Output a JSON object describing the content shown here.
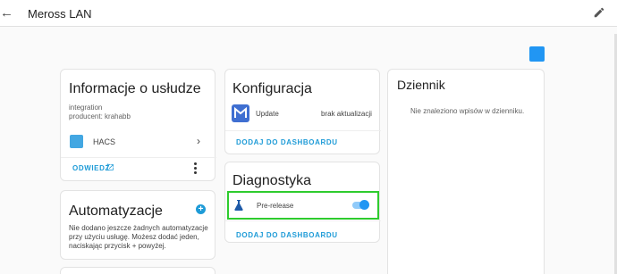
{
  "header": {
    "title": "Meross LAN",
    "back_icon": "arrow-back-icon",
    "edit_icon": "pencil-icon"
  },
  "device_card": {
    "title": "Informacje o usłudze",
    "integration_label": "integration",
    "producer_label": "producent: krahabb",
    "item_label": "HACS",
    "item_icon": "hacs-icon",
    "visit_label": "ODWIEDŹ",
    "visit_icon": "open-in-new-icon",
    "menu_icon": "more-vertical-icon"
  },
  "automation_card": {
    "title": "Automatyzacje",
    "add_icon": "plus-icon",
    "add_symbol": "+",
    "text_line1": "Nie dodano jeszcze żadnych automatyzacje",
    "text_line2": "przy użyciu usługę. Możesz dodać jeden,",
    "text_line3": "naciskając przycisk + powyżej."
  },
  "config_card": {
    "title": "Konfiguracja",
    "update_label": "Update",
    "update_status": "brak aktualizacji",
    "add_dashboard": "DODAJ DO DASHBOARDU"
  },
  "diag_card": {
    "title": "Diagnostyka",
    "prerelease_label": "Pre-release",
    "prerelease_icon": "flask-icon",
    "prerelease_on": true,
    "add_dashboard": "DODAJ DO DASHBOARDU"
  },
  "log_card": {
    "title": "Dziennik",
    "empty_text": "Nie znaleziono wpisów w dzienniku."
  },
  "colors": {
    "accent": "#1e9bd7",
    "highlight": "#2ecc2e"
  }
}
